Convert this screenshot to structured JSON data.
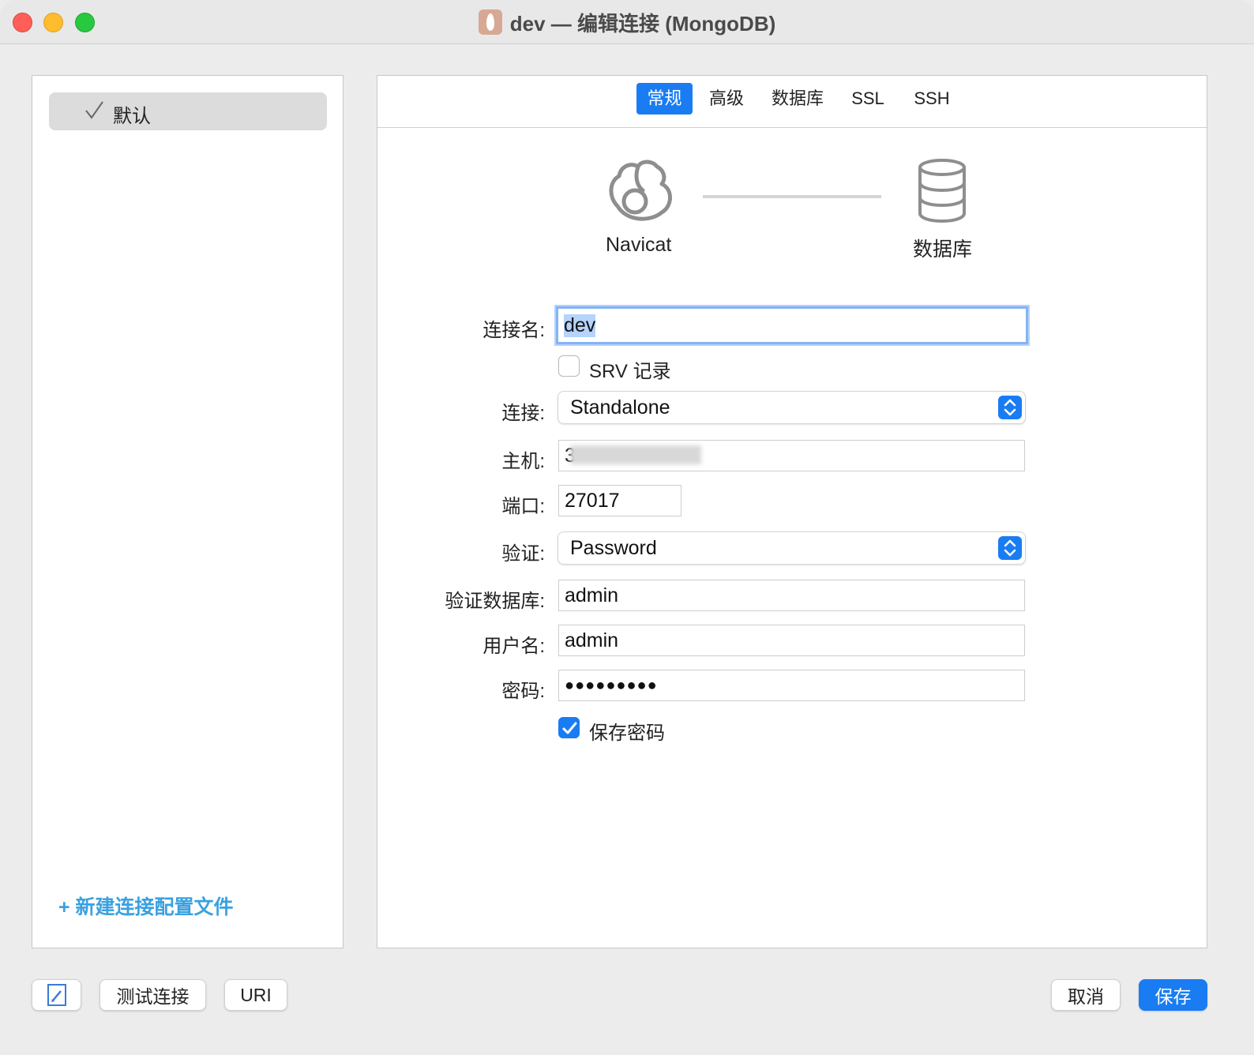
{
  "window": {
    "title": "dev — 编辑连接 (MongoDB)"
  },
  "sidebar": {
    "profile_label": "默认",
    "new_profile_label": "+ 新建连接配置文件"
  },
  "tabs": [
    {
      "label": "常规",
      "active": true
    },
    {
      "label": "高级",
      "active": false
    },
    {
      "label": "数据库",
      "active": false
    },
    {
      "label": "SSL",
      "active": false
    },
    {
      "label": "SSH",
      "active": false
    }
  ],
  "diagram": {
    "left_label": "Navicat",
    "right_label": "数据库"
  },
  "form": {
    "connection_name_label": "连接名:",
    "connection_name_value": "dev",
    "srv_label": "SRV 记录",
    "srv_checked": false,
    "connection_label": "连接:",
    "connection_value": "Standalone",
    "host_label": "主机:",
    "host_value": "3",
    "port_label": "端口:",
    "port_value": "27017",
    "auth_label": "验证:",
    "auth_value": "Password",
    "auth_db_label": "验证数据库:",
    "auth_db_value": "admin",
    "username_label": "用户名:",
    "username_value": "admin",
    "password_label": "密码:",
    "password_value": "●●●●●●●●●",
    "save_password_label": "保存密码",
    "save_password_checked": true
  },
  "footer": {
    "test_connection": "测试连接",
    "uri": "URI",
    "cancel": "取消",
    "save": "保存"
  },
  "colors": {
    "accent": "#1a7cf2",
    "link": "#3aa1e0"
  }
}
